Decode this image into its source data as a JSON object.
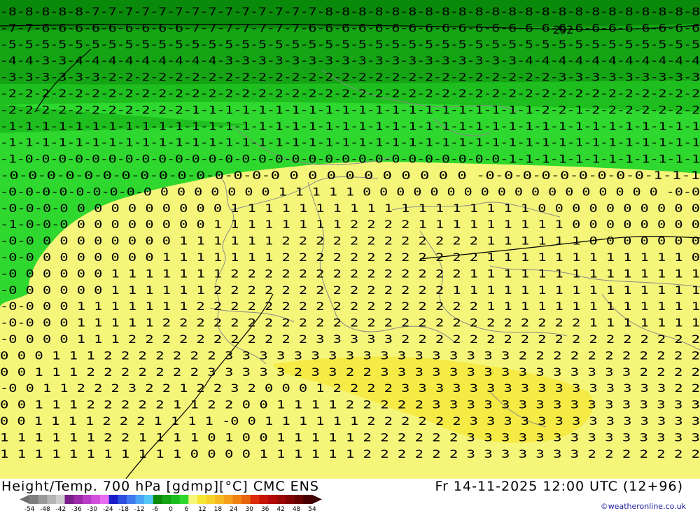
{
  "title": "Height/Temp. 700 hPa [gdmp][°C] CMC ENS",
  "valid_time": "Fr 14-11-2025 12:00 UTC (12+96)",
  "credit": "©weatheronline.co.uk",
  "legend": {
    "ticks": [
      "-54",
      "-48",
      "-42",
      "-36",
      "-30",
      "-24",
      "-18",
      "-12",
      "-6",
      "0",
      "6",
      "12",
      "18",
      "24",
      "30",
      "36",
      "42",
      "48",
      "54"
    ],
    "colors": [
      "#7f7f7f",
      "#9a9a9a",
      "#b4b4b4",
      "#cfcfcf",
      "#7a1e8c",
      "#9a2aa8",
      "#b83cc4",
      "#d24fdc",
      "#e86cf0",
      "#1b1bc9",
      "#2e4ee0",
      "#3f7af0",
      "#4aa6f5",
      "#56c8f6",
      "#0a8a0a",
      "#14a414",
      "#1ebe1e",
      "#2ed82e",
      "#f5f57a",
      "#f6e634",
      "#f6d22a",
      "#f6ba22",
      "#f6a01c",
      "#f08214",
      "#e6640e",
      "#dc2a0a",
      "#c81408",
      "#b40808",
      "#9a0606",
      "#800404",
      "#660202",
      "#4a0000"
    ]
  },
  "map": {
    "contour_label": "292",
    "rows": [
      "-8-8-8-8-8-7-7-7-7-7-7-7-7-7-7-7-7-7-7-8-8-8-8-8-8-8-8-8-8-8-8-8-8-8-8-8-8-8-8-8-8-8",
      "-7-7-6-6-6-6-6-6-6-6-6-7-7-7-7-7-7-7-6-6-6-6-6-6-6-6-6-6-6-6-6-6-6-6-6-6-6-6-6-6-6-6",
      "-5-5-5-5-5-5-5-5-5-5-5-5-5-5-5-5-5-5-5-5-5-5-5-5-5-5-5-5-5-5-5-5-5-5-5-5-5-5-5-5-5-5",
      "-4-4-3-3-4-4-4-4-4-4-4-4-4-3-3-3-3-3-3-3-3-3-3-3-3-3-3-3-3-3-3-4-4-4-4-4-4-4-4-4-4-4",
      "-3-3-3-3-3-3-2-2-2-2-2-2-2-2-2-2-2-2-2-2-2-2-2-2-2-2-2-2-2-2-2-2-2-3-3-3-3-3-3-3-3-3",
      "-2-2-2-2-2-2-2-2-2-2-2-2-2-2-2-2-2-2-2-2-2-2-2-2-2-2-2-2-2-2-2-2-2-2-2-2-2-2-2-2-2-2",
      "-2-2-2-2-2-2-2-2-2-2-2-1-1-1-1-1-1-1-1-1-1-1-1-1-1-1-1-1-1-1-1-1-2-2-1-2-2-2-2-2-2-2",
      "-1-1-1-1-1-1-1-1-1-1-1-1-1-1-1-1-1-1-1-1-1-1-1-1-1-1-1-1-1-1-1-1-1-1-1-1-1-1-1-1-1-1",
      "-1-1-1-1-1-1-1-1-1-1-1-1-1-1-1-1-1-1-1-1-1-1-1-1-1-1-1-1-1-1-1-1-1-1-1-1-1-1-1-1-1-1",
      "-1-0-0-0-0-0-0-0-0-0-0-0-0-0-0-0-0-0-0-0-0-0-0-0-0-0-0-0-0-0-1-1-1-1-1-1-1-1-1-1-1-1",
      "-0-0-0-0-0-0-0-0-0-0-0-0-0-0-0  0  0  0  0  0  0  0  0  0  0 -0-0-0-0-0-0-0-0-0-1-1-1",
      "-0-0-0-0-0-0-0-0-0 0 0 0 0 0 0 0 1 1 1 1 1 0 0 0 0 0 0 0 0 0 0 0 0 0 0 0 0 0 0 -0-0",
      "-0-0-0-0 0 0 0 0 0 0 0 0 0 1 1 1 1 1 1 1 1 1 1 1 1 1 1 1 1 1 1 0 0 0 0 0 0 0 0 0 0",
      "-1-0-0-0 0 0 0 0 0 0 0 0 1 1 1 1 1 1 1 1 2 2 2 2 1 1 1 1 1 1 1 1 1 0 0 0 0 0 0 0 0",
      "-0-0 0 0 0 0 0 0 0 0 1 1 1 1 1 1 2 2 2 2 2 2 2 2 2 2 2 2 1 1 1 1 1 1 0 0 0 0 0 0 0",
      "-0-0 0 0 0 0 0 0 0 1 1 1 1 1 1 1 2 2 2 2 2 2 2 2 2 2 2 2 1 1 1 1 1 1 1 1 1 1 1 1 0",
      "-0 0 0 0 0 0 1 1 1 1 1 1 1 2 2 2 2 2 2 2 2 2 2 2 2 2 2 1 1 1 1 1 1 1 1 1 1 1 1 1 1",
      "-0 0 0 0 0 0 1 1 1 1 1 1 2 2 2 2 2 2 2 2 2 2 2 2 2 2 1 1 1 1 1 1 1 1 1 1 1 1 1 1 1",
      "-0-0 0 0 1 1 1 1 1 1 1 2 2 2 2 2 2 2 2 2 2 2 2 2 2 2 2 2 1 1 1 1 1 1 1 1 1 1 1 1 1",
      "-0-0 0 0 1 1 1 1 1 2 2 2 2 2 2 2 2 2 2 2 2 2 2 2 2 2 2 2 2 2 2 2 2 2 1 1 1 1 1 1 1",
      "-0 0 0 0 1 1 1 2 2 2 2 2 2 2 2 2 2 2 3 3 3 3 3 2 2 2 2 2 2 2 2 2 2 2 2 2 2 2 2 2 2",
      "0 0 0 1 1 1 2 2 2 2 2 2 2 3 3 3 3 3 3 3 3 3 3 3 3 3 3 3 3 3 2 2 2 2 2 2 2 2 2 2 2",
      "0 0 1 1 1 2 2 2 2 2 2 2 3 3 3 3 3 2 3 3 2 2 3 3 3 3 3 3 3 3 3 3 3 3 3 3 3 2 2 2 2",
      "-0 0 1 1 2 2 2 3 2 2 1 2 2 3 2 0 0 0 1 2 2 2 2 3 3 3 3 3 3 3 3 3 3 3 3 3 3 3 3 2 2",
      "0 0 1 1 1 2 2 2 2 2 1 1 2 2 0 0 1 1 1 1 2 2 2 2 2 3 3 3 3 3 3 3 3 3 3 3 3 3 3 3 3",
      "0 0 1 1 1 1 2 2 2 1 1 1 1 -0 0 1 1 1 1 1 1 2 2 2 2 2 2 3 3 3 3 3 3 3 3 3 3 3 3 3 3",
      "1 1 1 1 1 1 2 2 1 1 1 1 0 1 0 0 1 1 1 1 1 2 2 2 2 2 2 3 3 3 3 3 3 3 3 3 3 3 3 3 3",
      "1 1 1 1 1 1 1 1 1 1 1 0 0 0 0 1 1 1 1 1 1 2 2 2 2 2 2 3 3 3 3 3 3 3 2 2 2 2 2 2 2"
    ]
  }
}
